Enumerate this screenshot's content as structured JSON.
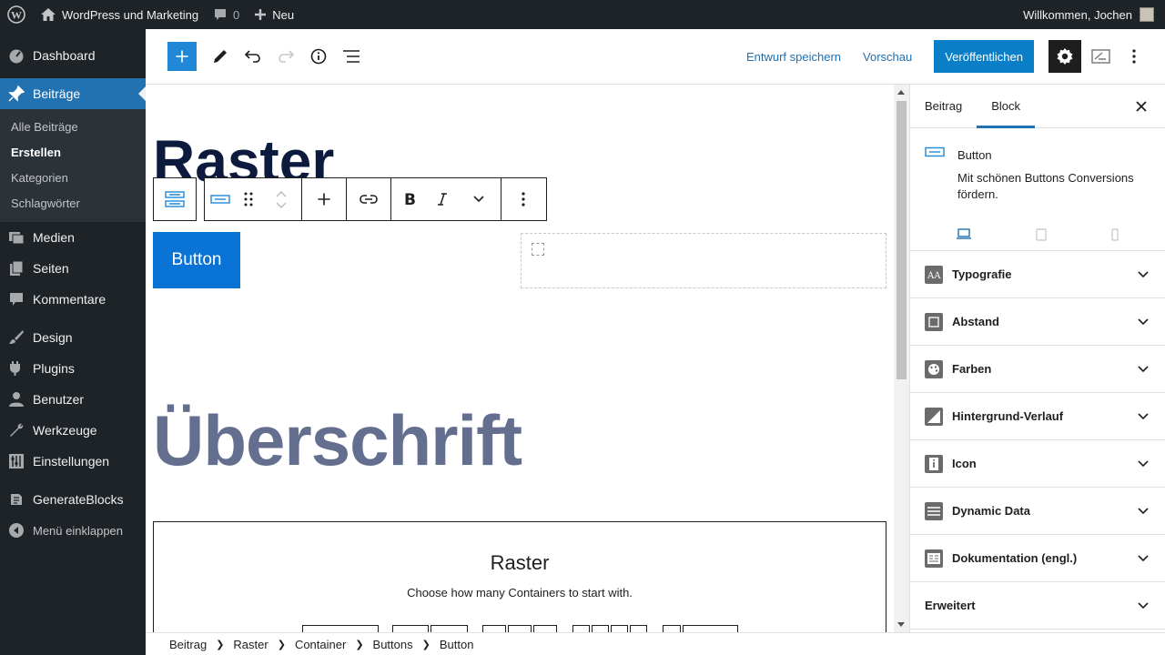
{
  "adminbar": {
    "site_name": "WordPress und Marketing",
    "comments_count": "0",
    "new_label": "Neu",
    "greeting": "Willkommen, Jochen"
  },
  "sidebar": {
    "dashboard": "Dashboard",
    "posts": "Beiträge",
    "sub": [
      "Alle Beiträge",
      "Erstellen",
      "Kategorien",
      "Schlagwörter"
    ],
    "media": "Medien",
    "pages": "Seiten",
    "comments": "Kommentare",
    "design": "Design",
    "plugins": "Plugins",
    "users": "Benutzer",
    "tools": "Werkzeuge",
    "settings": "Einstellungen",
    "generateblocks": "GenerateBlocks",
    "collapse": "Menü einklappen"
  },
  "header": {
    "save_draft": "Entwurf speichern",
    "preview": "Vorschau",
    "publish": "Veröffentlichen"
  },
  "canvas": {
    "title": "Raster",
    "button_text": "Button",
    "heading": "Überschrift",
    "grid_title": "Raster",
    "grid_subtitle": "Choose how many Containers to start with."
  },
  "inspector": {
    "tab_post": "Beitrag",
    "tab_block": "Block",
    "block_name": "Button",
    "block_desc": "Mit schönen Buttons Conversions fördern.",
    "panels": [
      "Typografie",
      "Abstand",
      "Farben",
      "Hintergrund-Verlauf",
      "Icon",
      "Dynamic Data",
      "Dokumentation (engl.)",
      "Erweitert"
    ]
  },
  "breadcrumb": [
    "Beitrag",
    "Raster",
    "Container",
    "Buttons",
    "Button"
  ],
  "colors": {
    "admin_dark": "#1d2327",
    "accent": "#2271b1",
    "button_blue": "#0a73d6",
    "heading_gray": "#646e8f"
  }
}
